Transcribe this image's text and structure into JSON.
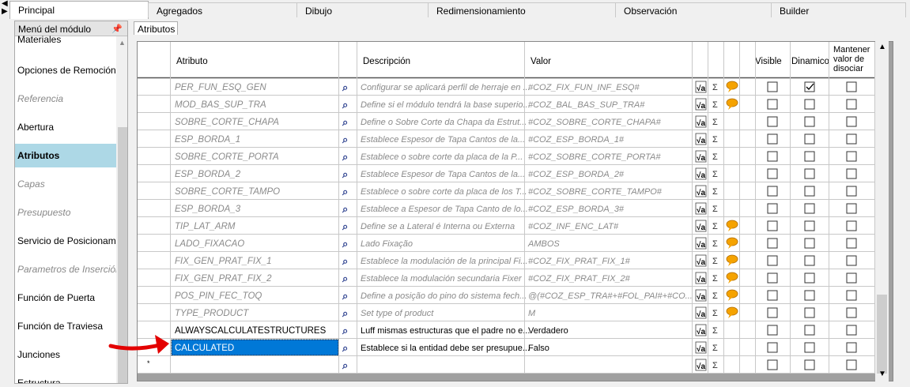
{
  "tabs": [
    "Principal",
    "Agregados",
    "Dibujo",
    "Redimensionamiento",
    "Observación",
    "Builder"
  ],
  "sidebar": {
    "title": "Menú del módulo",
    "items": [
      {
        "label": "Materiales",
        "state": "normal"
      },
      {
        "label": "Opciones de Remoción",
        "state": "normal"
      },
      {
        "label": "Referencia",
        "state": "disabled"
      },
      {
        "label": "Abertura",
        "state": "normal"
      },
      {
        "label": "Atributos",
        "state": "selected"
      },
      {
        "label": "Capas",
        "state": "disabled"
      },
      {
        "label": "Presupuesto",
        "state": "disabled"
      },
      {
        "label": "Servicio de Posicionamie",
        "state": "normal"
      },
      {
        "label": "Parametros de Inserción",
        "state": "disabled"
      },
      {
        "label": "Función de Puerta",
        "state": "normal"
      },
      {
        "label": "Función de Traviesa",
        "state": "normal"
      },
      {
        "label": "Junciones",
        "state": "normal"
      },
      {
        "label": "Estructura",
        "state": "normal"
      }
    ]
  },
  "subtab": "Atributos",
  "grid": {
    "headers": {
      "atributo": "Atributo",
      "descripcion": "Descripción",
      "valor": "Valor",
      "visible": "Visible",
      "dinamico": "Dinamico",
      "mantener": "Mantener valor de disociar"
    },
    "rows": [
      {
        "attr": "PER_FUN_ESQ_GEN",
        "desc": "Configurar se aplicará perfil de herraje en ...",
        "val": "#COZ_FIX_FUN_INF_ESQ#",
        "style": "disabled",
        "comment": true,
        "visible": false,
        "dinamico": true,
        "mantener": false
      },
      {
        "attr": "MOD_BAS_SUP_TRA",
        "desc": "Define si el módulo tendrá la base superio...",
        "val": "#COZ_BAL_BAS_SUP_TRA#",
        "style": "disabled",
        "comment": true,
        "visible": false,
        "dinamico": false,
        "mantener": false
      },
      {
        "attr": "SOBRE_CORTE_CHAPA",
        "desc": "Define o Sobre Corte da Chapa da Estrut...",
        "val": "#COZ_SOBRE_CORTE_CHAPA#",
        "style": "disabled",
        "comment": false,
        "visible": false,
        "dinamico": false,
        "mantener": false
      },
      {
        "attr": "ESP_BORDA_1",
        "desc": "Establece Espesor de Tapa Cantos de la...",
        "val": "#COZ_ESP_BORDA_1#",
        "style": "disabled",
        "comment": false,
        "visible": false,
        "dinamico": false,
        "mantener": false
      },
      {
        "attr": "SOBRE_CORTE_PORTA",
        "desc": "Establece o sobre corte da placa de la P...",
        "val": "#COZ_SOBRE_CORTE_PORTA#",
        "style": "disabled",
        "comment": false,
        "visible": false,
        "dinamico": false,
        "mantener": false
      },
      {
        "attr": "ESP_BORDA_2",
        "desc": "Establece Espesor de Tapa Cantos de la...",
        "val": "#COZ_ESP_BORDA_2#",
        "style": "disabled",
        "comment": false,
        "visible": false,
        "dinamico": false,
        "mantener": false
      },
      {
        "attr": "SOBRE_CORTE_TAMPO",
        "desc": "Establece o sobre corte da placa de los T...",
        "val": "#COZ_SOBRE_CORTE_TAMPO#",
        "style": "disabled",
        "comment": false,
        "visible": false,
        "dinamico": false,
        "mantener": false
      },
      {
        "attr": "ESP_BORDA_3",
        "desc": "Establece a Espesor de Tapa Canto de lo...",
        "val": "#COZ_ESP_BORDA_3#",
        "style": "disabled",
        "comment": false,
        "visible": false,
        "dinamico": false,
        "mantener": false
      },
      {
        "attr": "TIP_LAT_ARM",
        "desc": "Define se a Lateral é Interna ou Externa",
        "val": "#COZ_INF_ENC_LAT#",
        "style": "disabled",
        "comment": true,
        "visible": false,
        "dinamico": false,
        "mantener": false
      },
      {
        "attr": "LADO_FIXACAO",
        "desc": "Lado Fixação",
        "val": "AMBOS",
        "style": "disabled",
        "comment": true,
        "visible": false,
        "dinamico": false,
        "mantener": false
      },
      {
        "attr": "FIX_GEN_PRAT_FIX_1",
        "desc": "Establece la modulación de la principal Fi...",
        "val": "#COZ_FIX_PRAT_FIX_1#",
        "style": "disabled",
        "comment": true,
        "visible": false,
        "dinamico": false,
        "mantener": false
      },
      {
        "attr": "FIX_GEN_PRAT_FIX_2",
        "desc": "Establece la modulación secundaria Fixer",
        "val": "#COZ_FIX_PRAT_FIX_2#",
        "style": "disabled",
        "comment": true,
        "visible": false,
        "dinamico": false,
        "mantener": false
      },
      {
        "attr": "POS_PIN_FEC_TOQ",
        "desc": "Define a posição do pino do sistema fech...",
        "val": "@(#COZ_ESP_TRA#+#FOL_PAI#+#CO...",
        "style": "disabled",
        "comment": true,
        "visible": false,
        "dinamico": false,
        "mantener": false
      },
      {
        "attr": "TYPE_PRODUCT",
        "desc": "Set type of product",
        "val": "M",
        "style": "disabled",
        "comment": true,
        "visible": false,
        "dinamico": false,
        "mantener": false
      },
      {
        "attr": "ALWAYSCALCULATESTRUCTURES",
        "desc": "Luff mismas estructuras que el padre no e...",
        "val": "Verdadero",
        "style": "normal",
        "comment": false,
        "visible": false,
        "dinamico": false,
        "mantener": false
      },
      {
        "attr": "CALCULATED",
        "desc": "Establece si la entidad debe ser presupue...",
        "val": "Falso",
        "style": "selected",
        "comment": false,
        "visible": false,
        "dinamico": false,
        "mantener": false
      },
      {
        "attr": "",
        "desc": "",
        "val": "",
        "style": "new",
        "comment": false,
        "visible": false,
        "dinamico": false,
        "mantener": false
      }
    ],
    "new_row_marker": "*",
    "sigma_glyph": "Σ",
    "sqrt_glyph": "√a",
    "binoculars_glyph": "⌕"
  },
  "colors": {
    "selection": "#0078d7",
    "sidebar_selected": "#add8e6",
    "disabled_text": "#8a8a8a",
    "arrow": "#e30000",
    "comment_icon": "#f5a300"
  }
}
